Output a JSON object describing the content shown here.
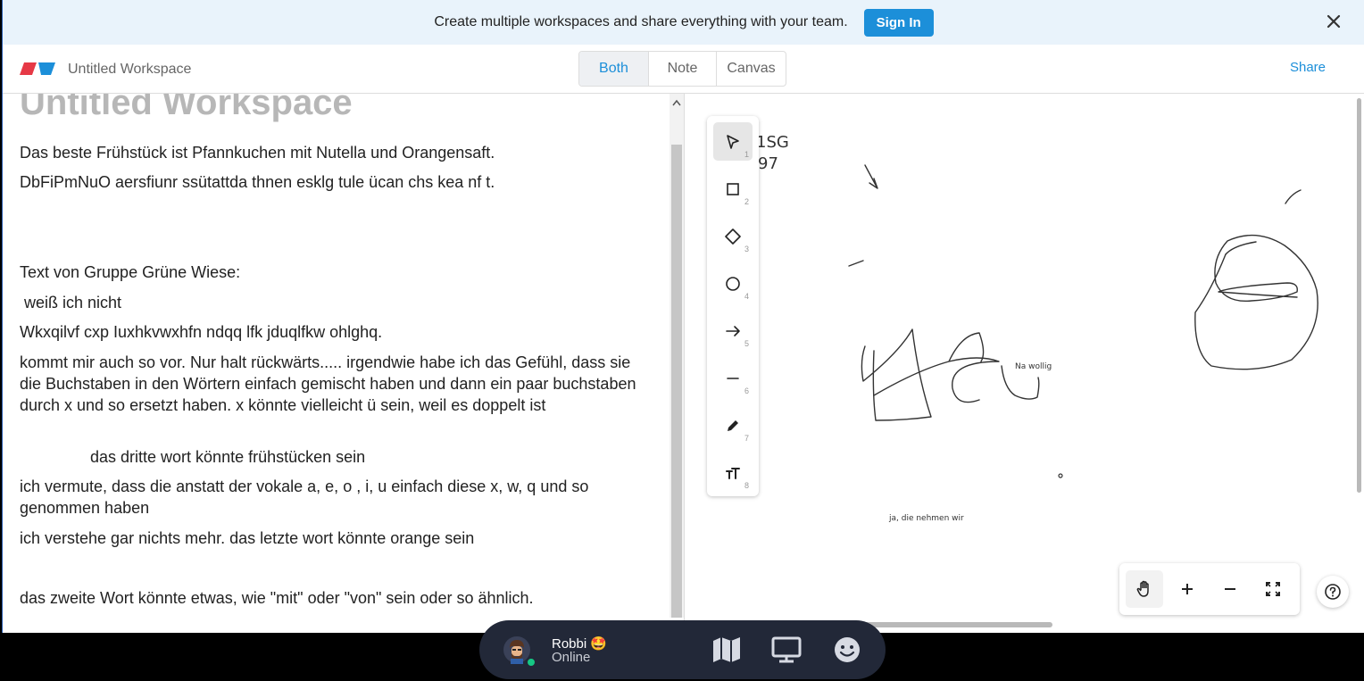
{
  "banner": {
    "message": "Create multiple workspaces and share everything with your team.",
    "signin_label": "Sign In"
  },
  "header": {
    "workspace_name": "Untitled Workspace",
    "tabs": [
      {
        "label": "Both",
        "active": true
      },
      {
        "label": "Note",
        "active": false
      },
      {
        "label": "Canvas",
        "active": false
      }
    ],
    "share_label": "Share"
  },
  "note": {
    "title": "Untitled Workspace",
    "paragraphs": [
      "Das beste Frühstück ist Pfannkuchen mit Nutella und Orangensaft.",
      "DbFiPmNuO aersfiunr ssütattda thnen esklg tule ücan chs kea nf t.",
      "Text von Gruppe Grüne Wiese:",
      " weiß ich nicht",
      "Wkxqilvf cxp Iuxhkvwxhfn ndqq lfk jduqlfkw ohlghq.",
      "kommt mir auch so vor. Nur halt rückwärts..... irgendwie habe ich das Gefühl, dass sie die Buchstaben in den Wörtern einfach gemischt haben und dann ein paar buchstaben durch x und so ersetzt haben. x könnte vielleicht ü sein, weil es doppelt ist",
      "das dritte wort könnte frühstücken sein",
      "ich vermute, dass die anstatt der vokale a, e, o , i, u einfach diese x, w, q und so genommen haben",
      "ich verstehe gar nichts mehr. das letzte wort könnte orange sein",
      "das zweite Wort könnte etwas, wie \"mit\" oder \"von\" sein oder so ähnlich."
    ]
  },
  "canvas": {
    "tools": [
      {
        "icon": "cursor-icon",
        "shortcut": "1"
      },
      {
        "icon": "rectangle-icon",
        "shortcut": "2"
      },
      {
        "icon": "diamond-icon",
        "shortcut": "3"
      },
      {
        "icon": "ellipse-icon",
        "shortcut": "4"
      },
      {
        "icon": "arrow-icon",
        "shortcut": "5"
      },
      {
        "icon": "line-icon",
        "shortcut": "6"
      },
      {
        "icon": "pencil-icon",
        "shortcut": "7"
      },
      {
        "icon": "text-icon",
        "shortcut": "8"
      }
    ],
    "handwriting": [
      "1SG",
      "97",
      "ja, die nehmen wir",
      "Na wollig"
    ],
    "zoom_controls": [
      "hand-icon",
      "zoom-in-icon",
      "zoom-out-icon",
      "fit-screen-icon"
    ],
    "help_icon": "help-icon"
  },
  "presence": {
    "name": "Robbi 🤩",
    "status": "Online",
    "status_color": "#16c784",
    "icons": [
      "map-icon",
      "screen-icon",
      "emoji-icon"
    ]
  },
  "colors": {
    "accent": "#1c8fd9",
    "banner_bg": "#e9f3fb",
    "presence_bg": "#222838"
  }
}
